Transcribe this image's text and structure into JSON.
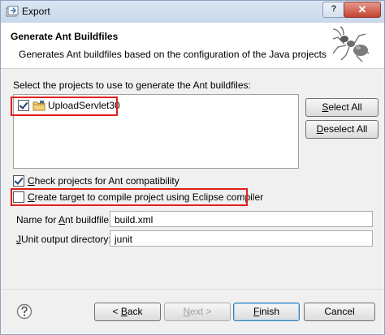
{
  "window": {
    "title": "Export",
    "help_button": "?",
    "close_button": "✕"
  },
  "banner": {
    "title": "Generate Ant Buildfiles",
    "description": "Generates Ant buildfiles based on the configuration of the Java projects"
  },
  "projects": {
    "label": "Select the projects to use to generate the Ant buildfiles:",
    "items": [
      {
        "name": "UploadServlet30",
        "checked": true
      }
    ],
    "select_all": {
      "mnemonic": "S",
      "rest": "elect All"
    },
    "deselect_all": {
      "mnemonic": "D",
      "rest": "eselect All"
    }
  },
  "options": {
    "check_compat": {
      "mnemonic": "C",
      "rest": "heck projects for Ant compatibility",
      "checked": true
    },
    "create_target": {
      "mnemonic": "C",
      "rest": "reate target to compile project using Eclipse compiler",
      "checked": false
    }
  },
  "fields": {
    "buildfile": {
      "label_pre": "Name for ",
      "mnemonic": "A",
      "label_post": "nt buildfile:",
      "value": "build.xml"
    },
    "junit": {
      "mnemonic": "J",
      "label_post": "Unit output directory:",
      "value": "junit"
    }
  },
  "buttons": {
    "back": {
      "prefix": "< ",
      "mnemonic": "B",
      "rest": "ack"
    },
    "next": {
      "mnemonic": "N",
      "rest": "ext >"
    },
    "finish": {
      "mnemonic": "F",
      "rest": "inish"
    },
    "cancel": "Cancel"
  },
  "colors": {
    "highlight": "#e0201e",
    "title_bar": "#c9d8ea",
    "dialog_bg": "#f0f0f0"
  }
}
